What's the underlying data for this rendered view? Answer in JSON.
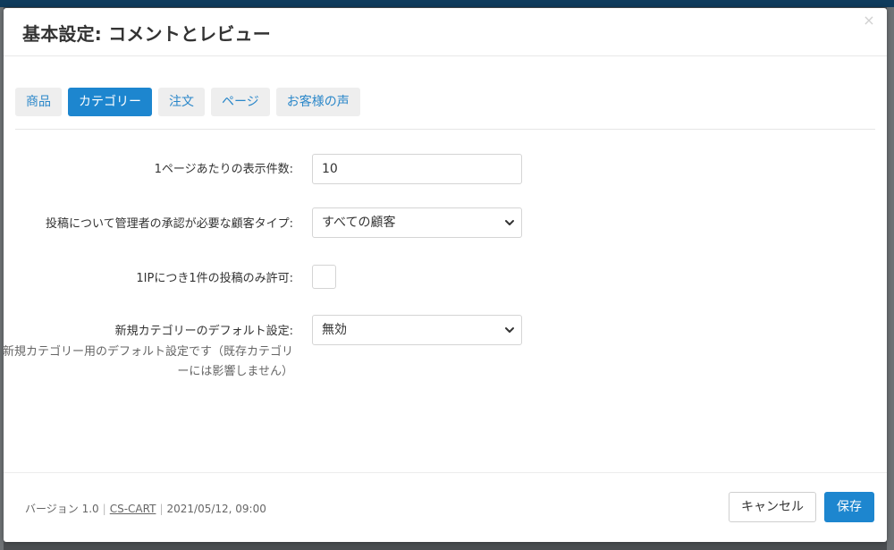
{
  "dialog": {
    "title": "基本設定: コメントとレビュー",
    "close_glyph": "×"
  },
  "tabs": [
    {
      "label": "商品",
      "active": false
    },
    {
      "label": "カテゴリー",
      "active": true
    },
    {
      "label": "注文",
      "active": false
    },
    {
      "label": "ページ",
      "active": false
    },
    {
      "label": "お客様の声",
      "active": false
    }
  ],
  "fields": {
    "per_page": {
      "label": "1ページあたりの表示件数:",
      "value": "10"
    },
    "approval": {
      "label": "投稿について管理者の承認が必要な顧客タイプ:",
      "value": "すべての顧客"
    },
    "one_per_ip": {
      "label": "1IPにつき1件の投稿のみ許可:",
      "checked": false
    },
    "default_setting": {
      "label": "新規カテゴリーのデフォルト設定:",
      "value": "無効",
      "hint": "新規カテゴリー用のデフォルト設定です（既存カテゴリーには影響しません）"
    }
  },
  "footer": {
    "version": "バージョン 1.0",
    "vendor": "CS-CART",
    "date": "2021/05/12, 09:00",
    "cancel_label": "キャンセル",
    "save_label": "保存"
  },
  "colors": {
    "accent": "#1d86cf",
    "tab_link": "#2a87c9"
  },
  "icons": {
    "close": "close-icon",
    "select_arrow": "chevron-down-icon"
  }
}
